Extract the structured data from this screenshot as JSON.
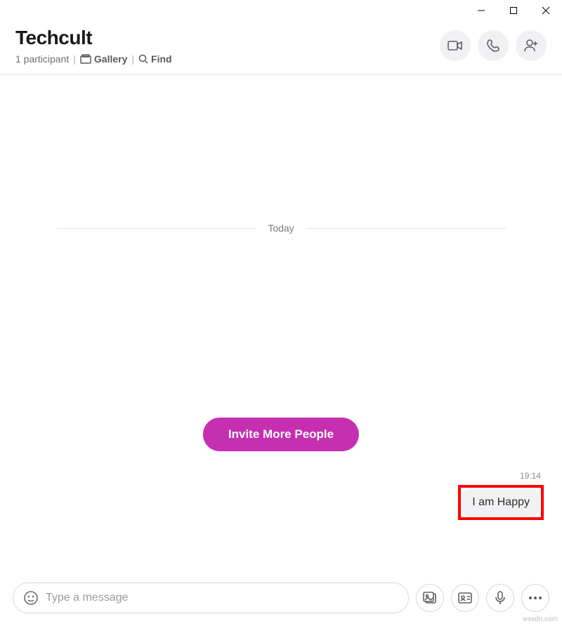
{
  "window_controls": {
    "minimize": "minimize",
    "maximize": "maximize",
    "close": "close"
  },
  "header": {
    "title": "Techcult",
    "participants": "1 participant",
    "gallery": "Gallery",
    "find": "Find"
  },
  "actions": {
    "video": "video-call",
    "audio": "audio-call",
    "add": "add-participant"
  },
  "chat": {
    "date_label": "Today",
    "invite_label": "Invite More People",
    "message_time": "19:14",
    "message_text": "I am Happy"
  },
  "composer": {
    "placeholder": "Type a message"
  },
  "watermark": "wsxdn.com"
}
